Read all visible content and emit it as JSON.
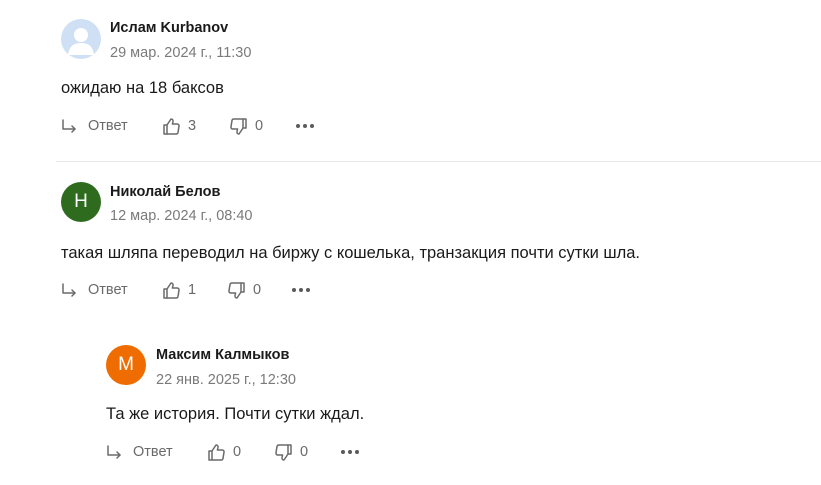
{
  "comments": [
    {
      "author": "Ислам Kurbanov",
      "date": "29 мар. 2024 г., 11:30",
      "text": "ожидаю на 18 баксов",
      "avatar": {
        "type": "placeholder",
        "color": "#cfe0f5",
        "icon": "user-silhouette-icon"
      },
      "reply_label": "Ответ",
      "likes": "3",
      "dislikes": "0"
    },
    {
      "author": "Николай Белов",
      "date": "12 мар. 2024 г., 08:40",
      "text": "такая шляпа переводил на биржу с кошелька, транзакция почти сутки шла.",
      "avatar": {
        "type": "initial",
        "letter": "Н",
        "color": "#2e6b1e"
      },
      "reply_label": "Ответ",
      "likes": "1",
      "dislikes": "0"
    },
    {
      "author": "Максим Калмыков",
      "date": "22 янв. 2025 г., 12:30",
      "text": "Та же история. Почти сутки ждал.",
      "avatar": {
        "type": "initial",
        "letter": "М",
        "color": "#ef6c00"
      },
      "reply_label": "Ответ",
      "likes": "0",
      "dislikes": "0"
    }
  ]
}
